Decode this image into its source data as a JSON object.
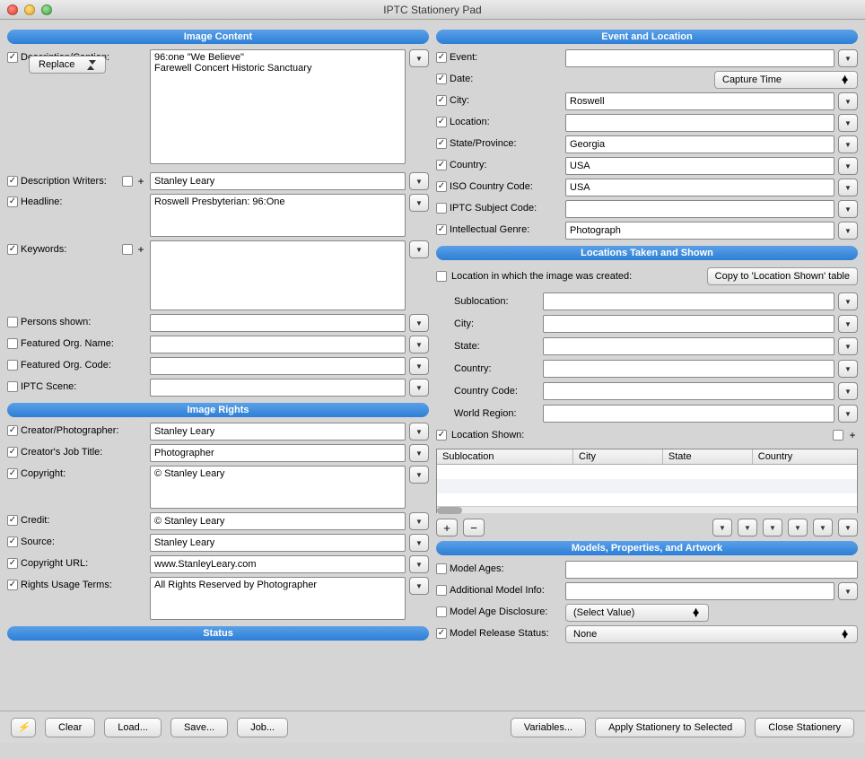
{
  "window": {
    "title": "IPTC Stationery Pad"
  },
  "sections": {
    "image_content": "Image Content",
    "image_rights": "Image Rights",
    "status": "Status",
    "event_location": "Event and Location",
    "locations": "Locations Taken and Shown",
    "models": "Models, Properties, and Artwork"
  },
  "labels": {
    "description": "Description/Caption:",
    "replace": "Replace",
    "desc_writers": "Description Writers:",
    "headline": "Headline:",
    "keywords": "Keywords:",
    "persons": "Persons shown:",
    "org_name": "Featured Org. Name:",
    "org_code": "Featured Org. Code:",
    "iptc_scene": "IPTC Scene:",
    "creator": "Creator/Photographer:",
    "job_title": "Creator's Job Title:",
    "copyright": "Copyright:",
    "credit": "Credit:",
    "source": "Source:",
    "copy_url": "Copyright URL:",
    "rights_terms": "Rights Usage Terms:",
    "event": "Event:",
    "date": "Date:",
    "city": "City:",
    "location": "Location:",
    "state": "State/Province:",
    "country": "Country:",
    "iso_country": "ISO Country Code:",
    "iptc_subject": "IPTC Subject Code:",
    "intel_genre": "Intellectual Genre:",
    "loc_created": "Location in which the image was created:",
    "copy_to_shown": "Copy to 'Location Shown' table",
    "sublocation": "Sublocation:",
    "city2": "City:",
    "state2": "State:",
    "country2": "Country:",
    "country_code": "Country Code:",
    "world_region": "World Region:",
    "location_shown": "Location Shown:",
    "model_ages": "Model Ages:",
    "addl_model": "Additional Model Info:",
    "model_age_disc": "Model Age Disclosure:",
    "model_release": "Model Release Status:",
    "capture_time": "Capture Time",
    "select_value": "(Select Value)",
    "none": "None"
  },
  "values": {
    "description": "96:one \"We Believe\"\nFarewell Concert Historic Sanctuary",
    "desc_writers": "Stanley Leary",
    "headline": "Roswell Presbyterian: 96:One",
    "keywords": "",
    "persons": "",
    "org_name": "",
    "org_code": "",
    "iptc_scene": "",
    "creator": "Stanley Leary",
    "job_title": "Photographer",
    "copyright": "© Stanley Leary",
    "credit": "© Stanley Leary",
    "source": "Stanley Leary",
    "copy_url": "www.StanleyLeary.com",
    "rights_terms": "All Rights Reserved by Photographer",
    "event": "",
    "city_ev": "Roswell",
    "location": "",
    "state_ev": "Georgia",
    "country_ev": "USA",
    "iso_country": "USA",
    "iptc_subject": "",
    "intel_genre": "Photograph",
    "sublocation": "",
    "city2": "",
    "state2": "",
    "country2": "",
    "country_code": "",
    "world_region": "",
    "model_ages": "",
    "addl_model": ""
  },
  "table": {
    "cols": [
      "Sublocation",
      "City",
      "State",
      "Country"
    ]
  },
  "footer": {
    "clear": "Clear",
    "load": "Load...",
    "save": "Save...",
    "job": "Job...",
    "variables": "Variables...",
    "apply": "Apply Stationery to Selected",
    "close": "Close Stationery"
  }
}
